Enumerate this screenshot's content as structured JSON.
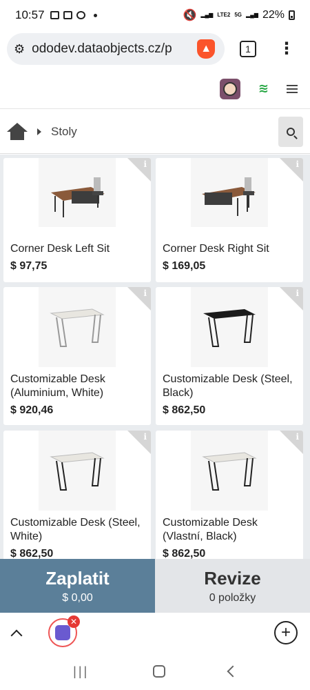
{
  "statusbar": {
    "time": "10:57",
    "battery": "22%"
  },
  "browser": {
    "url": "ododev.dataobjects.cz/p",
    "tab_count": "1"
  },
  "breadcrumb": {
    "current": "Stoly"
  },
  "products": [
    {
      "name": "Corner Desk Left Sit",
      "price": "$ 97,75",
      "image": "desk-corner"
    },
    {
      "name": "Corner Desk Right Sit",
      "price": "$ 169,05",
      "image": "desk-corner"
    },
    {
      "name": "Customizable Desk (Aluminium, White)",
      "price": "$ 920,46",
      "image": "desk-white"
    },
    {
      "name": "Customizable Desk (Steel, Black)",
      "price": "$ 862,50",
      "image": "desk-black"
    },
    {
      "name": "Customizable Desk (Steel, White)",
      "price": "$ 862,50",
      "image": "desk-white"
    },
    {
      "name": "Customizable Desk (Vlastní, Black)",
      "price": "$ 862,50",
      "image": "desk-white"
    }
  ],
  "pay": {
    "label": "Zaplatit",
    "amount": "$ 0,00"
  },
  "review": {
    "label": "Revize",
    "count": "0 položky"
  },
  "colors": {
    "pay_bg": "#5b7f99",
    "review_bg": "#e3e5e8",
    "online": "#28a745"
  }
}
